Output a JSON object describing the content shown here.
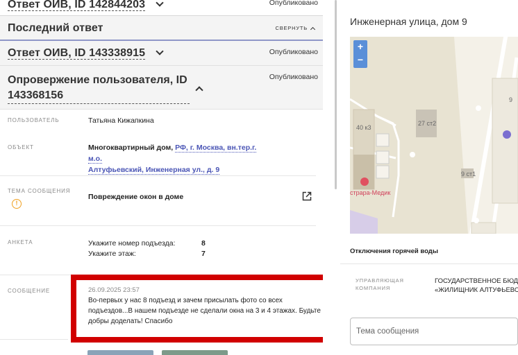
{
  "left": {
    "acc1": {
      "title": "Ответ ОИВ, ID 142844203",
      "status": "Опубликовано"
    },
    "last": {
      "title": "Последний ответ",
      "collapse": "СВЕРНУТЬ"
    },
    "acc2": {
      "title": "Ответ ОИВ, ID 143338915",
      "status": "Опубликовано"
    },
    "acc3": {
      "title_line1": "Опровержение пользователя, ID",
      "title_line2": "143368156",
      "status": "Опубликовано"
    },
    "user": {
      "label": "ПОЛЬЗОВАТЕЛЬ",
      "value": "Татьяна Кижапкина"
    },
    "object": {
      "label": "ОБЪЕКТ",
      "prefix": "Многоквартирный дом,",
      "link1": "РФ, г. Москва, вн.тер.г. м.о.",
      "link2": "Алтуфьевский, Инженерная ул., д. 9"
    },
    "topic": {
      "label": "ТЕМА СООБЩЕНИЯ",
      "value": "Повреждение окон в доме"
    },
    "form": {
      "label": "АНКЕТА",
      "items": [
        {
          "q": "Укажите номер подъезда:",
          "a": "8"
        },
        {
          "q": "Укажите этаж:",
          "a": "7"
        }
      ]
    },
    "message": {
      "label": "СООБЩЕНИЕ",
      "date": "26.09.2025 23:57",
      "line1": "Во-первых у нас 8 подъезд и зачем присылать фото со всех",
      "line2": "подъездов...В нашем подъезде не сделали окна на 3 и 4 этажах. Будьте",
      "line3": "добры доделать! Спасибо"
    }
  },
  "right": {
    "address": "Инженерная улица, дом 9",
    "map": {
      "zoom_in": "+",
      "zoom_out": "−",
      "labels": [
        "9",
        "40 к3",
        "27 ст2",
        "9 ст1"
      ],
      "poi": "страра-Медик"
    },
    "outage": "Отключения горячей воды",
    "company": {
      "label_line1": "УПРАВЛЯЮЩАЯ",
      "label_line2": "КОМПАНИЯ",
      "value_line1": "ГОСУДАРСТВЕННОЕ БЮДЖ",
      "value_line2": "«ЖИЛИЩНИК АЛТУФЬЕВС"
    },
    "subject_placeholder": "Тема сообщения"
  },
  "colors": {
    "accent": "#4a55b5",
    "highlight": "#d10000",
    "warning": "#f0a020"
  }
}
